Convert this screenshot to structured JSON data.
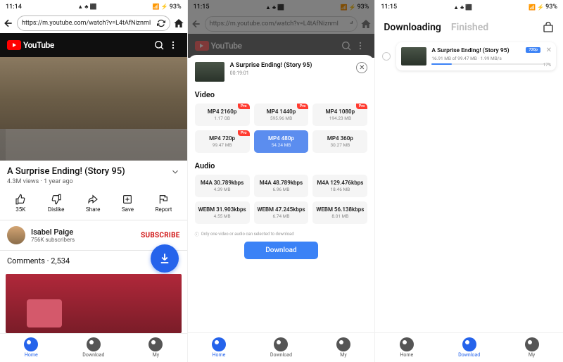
{
  "status": {
    "time1": "11:14",
    "time2": "11:15",
    "time3": "11:15",
    "battery": "93%"
  },
  "url": "https://m.youtube.com/watch?v=L4tAfNiznmI",
  "yt": {
    "brand": "YouTube"
  },
  "video": {
    "title": "A Surprise Ending! (Story 95)",
    "views": "4.3M views",
    "age": "1 year ago",
    "duration": "00:19:01"
  },
  "actions": {
    "like": "35K",
    "dislike": "Dislike",
    "share": "Share",
    "save": "Save",
    "report": "Report"
  },
  "channel": {
    "name": "Isabel Paige",
    "subs": "756K subscribers",
    "subscribe": "SUBSCRIBE"
  },
  "comments": {
    "label": "Comments",
    "count": "2,534"
  },
  "sheet": {
    "video_label": "Video",
    "audio_label": "Audio",
    "note": "Only one video or audio can selected to download",
    "download": "Download",
    "video_opts": [
      {
        "l1": "MP4 2160p",
        "l2": "1.17 GB",
        "pro": true
      },
      {
        "l1": "MP4 1440p",
        "l2": "595.96 MB",
        "pro": true
      },
      {
        "l1": "MP4 1080p",
        "l2": "194.23 MB",
        "pro": true
      },
      {
        "l1": "MP4 720p",
        "l2": "99.47 MB",
        "pro": true
      },
      {
        "l1": "MP4 480p",
        "l2": "54.24 MB",
        "pro": false,
        "selected": true
      },
      {
        "l1": "MP4 360p",
        "l2": "30.27 MB",
        "pro": false
      }
    ],
    "audio_opts": [
      {
        "l1": "M4A 30.789kbps",
        "l2": "4.39 MB"
      },
      {
        "l1": "M4A 48.789kbps",
        "l2": "6.96 MB"
      },
      {
        "l1": "M4A 129.476kbps",
        "l2": "18.46 MB"
      },
      {
        "l1": "WEBM 31.903kbps",
        "l2": "4.55 MB"
      },
      {
        "l1": "WEBM 47.245kbps",
        "l2": "6.74 MB"
      },
      {
        "l1": "WEBM 56.138kbps",
        "l2": "8.01 MB"
      }
    ],
    "pro_label": "Pro"
  },
  "dl": {
    "tab_downloading": "Downloading",
    "tab_finished": "Finished",
    "item_title": "A Surprise Ending! (Story 95)",
    "progress": "16.91 MB of 99.47 MB · 1.99 MB/s",
    "badge": "720p",
    "pct": "17%"
  },
  "nav": {
    "home": "Home",
    "download": "Download",
    "my": "My"
  }
}
